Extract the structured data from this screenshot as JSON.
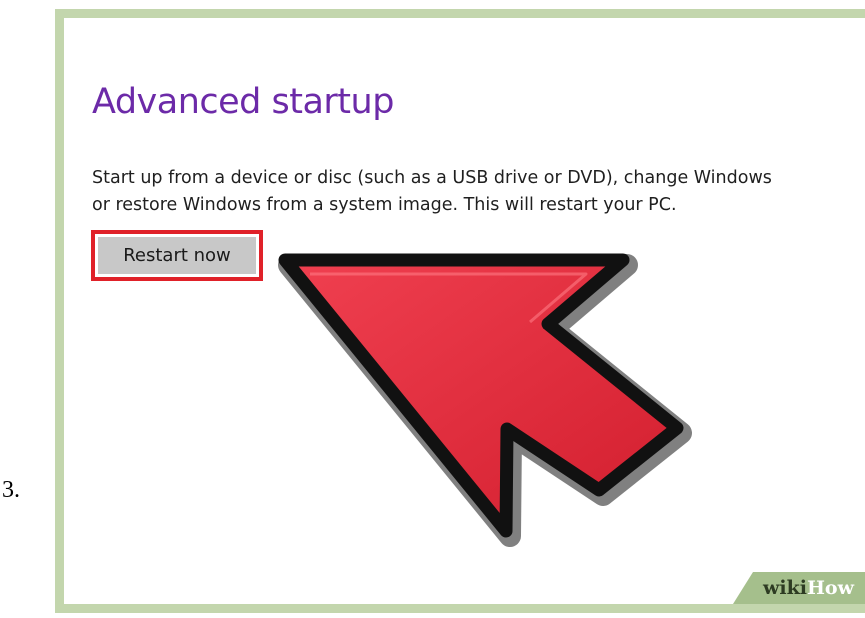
{
  "step": {
    "number": "3."
  },
  "settings": {
    "title": "Advanced startup",
    "description_lines": [
      "Start up from a device or disc (such as a USB drive or DVD), change Windows",
      "or restore Windows from a system image. This will restart your PC."
    ],
    "restart_label": "Restart now"
  },
  "watermark": {
    "part1": "wiki",
    "part2": "How"
  },
  "colors": {
    "frame_border": "#c3d6ad",
    "title": "#6c2aa8",
    "highlight_outline": "#e02129",
    "button_bg": "#c8c8c8",
    "arrow_fill": "#e02635",
    "arrow_outline": "#111111"
  },
  "icons": {
    "pointer": "large-red-arrow-pointer-icon"
  }
}
